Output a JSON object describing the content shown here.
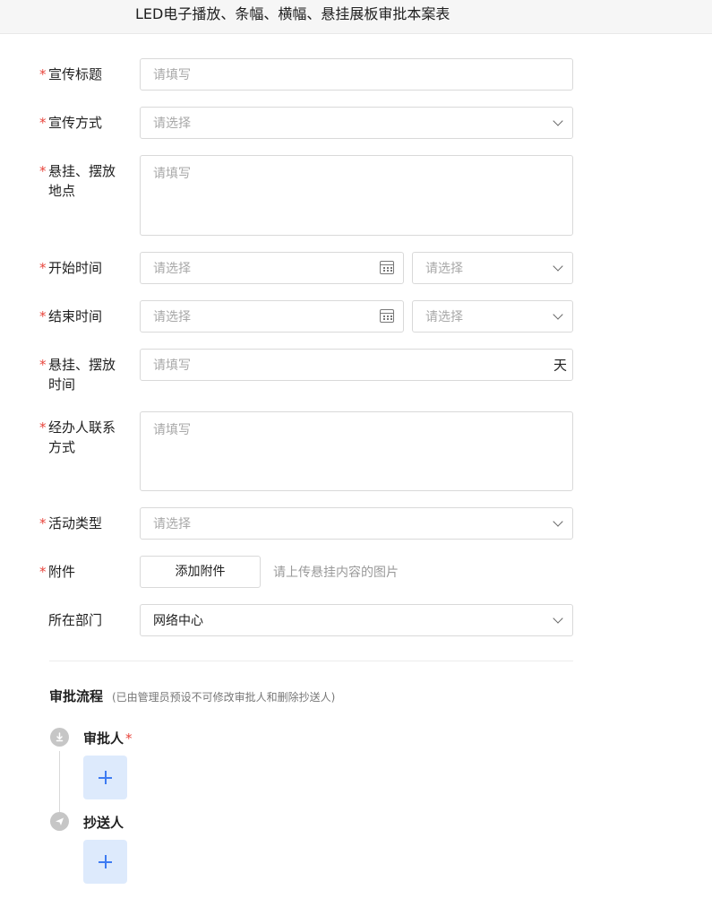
{
  "form_title": "LED电子播放、条幅、横幅、悬挂展板审批本案表",
  "fields": {
    "title": {
      "label": "宣传标题",
      "placeholder": "请填写"
    },
    "method": {
      "label": "宣传方式",
      "placeholder": "请选择"
    },
    "location": {
      "label": "悬挂、摆放地点",
      "placeholder": "请填写"
    },
    "start_time": {
      "label": "开始时间",
      "date_placeholder": "请选择",
      "time_placeholder": "请选择"
    },
    "end_time": {
      "label": "结束时间",
      "date_placeholder": "请选择",
      "time_placeholder": "请选择"
    },
    "duration": {
      "label": "悬挂、摆放时间",
      "placeholder": "请填写",
      "suffix": "天"
    },
    "contact": {
      "label": "经办人联系方式",
      "placeholder": "请填写"
    },
    "activity_type": {
      "label": "活动类型",
      "placeholder": "请选择"
    },
    "attachment": {
      "label": "附件",
      "button": "添加附件",
      "hint": "请上传悬挂内容的图片"
    },
    "department": {
      "label": "所在部门",
      "value": "网络中心"
    }
  },
  "required_mark": "*",
  "approval_flow": {
    "title": "审批流程",
    "note": "(已由管理员预设不可修改审批人和删除抄送人)",
    "approver_label": "审批人",
    "cc_label": "抄送人",
    "add_symbol": "+"
  },
  "colors": {
    "required": "#e8453c",
    "add_accent": "#3d7bf2",
    "add_bg": "#ddeafc"
  }
}
